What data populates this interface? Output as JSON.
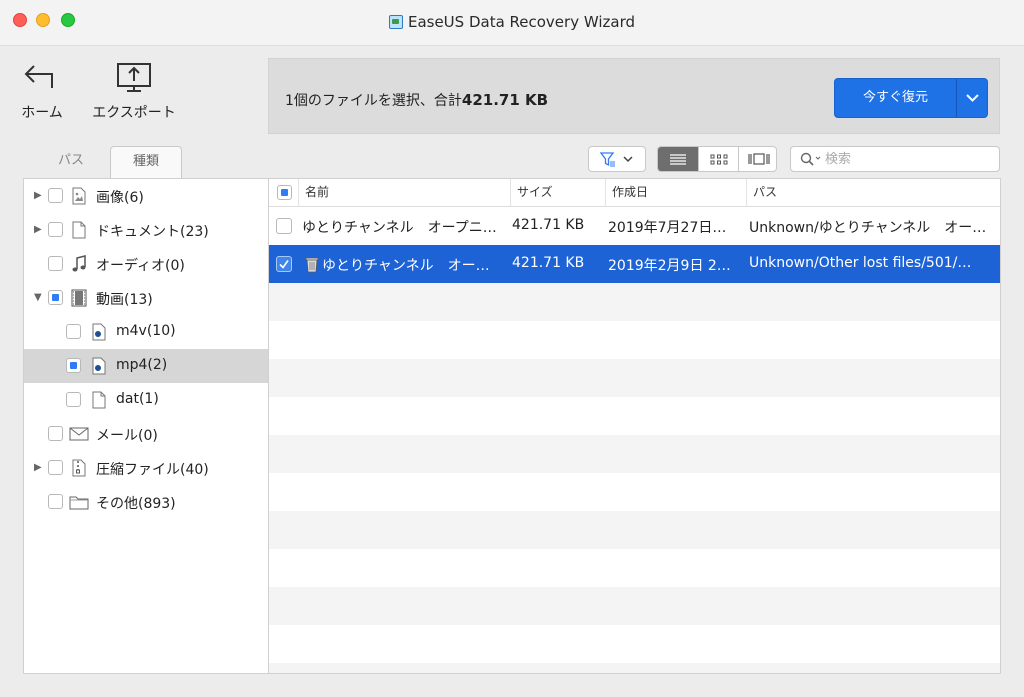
{
  "window": {
    "title": "EaseUS Data Recovery Wizard"
  },
  "toolbar": {
    "home_label": "ホーム",
    "export_label": "エクスポート"
  },
  "summary": {
    "prefix": "1個のファイルを選択、合計",
    "size": "421.71 KB"
  },
  "recover_button": {
    "label": "今すぐ復元"
  },
  "tabs": {
    "path": "パス",
    "type": "種類"
  },
  "tree": [
    {
      "label": "画像(6)",
      "icon": "image-file-icon"
    },
    {
      "label": "ドキュメント(23)",
      "icon": "document-icon"
    },
    {
      "label": "オーディオ(0)",
      "icon": "music-note-icon"
    },
    {
      "label": "動画(13)",
      "icon": "film-icon"
    },
    {
      "label": "m4v(10)",
      "icon": "video-file-icon"
    },
    {
      "label": "mp4(2)",
      "icon": "video-file-icon"
    },
    {
      "label": "dat(1)",
      "icon": "blank-file-icon"
    },
    {
      "label": "メール(0)",
      "icon": "envelope-icon"
    },
    {
      "label": "圧縮ファイル(40)",
      "icon": "zip-file-icon"
    },
    {
      "label": "その他(893)",
      "icon": "folder-icon"
    }
  ],
  "search": {
    "placeholder": "検索"
  },
  "table": {
    "columns": [
      "名前",
      "サイズ",
      "作成日",
      "パス"
    ],
    "rows": [
      {
        "name": "ゆとりチャンネル　オープニ…",
        "size": "421.71 KB",
        "date": "2019年7月27日…",
        "path": "Unknown/ゆとりチャンネル　オー…",
        "checked": false
      },
      {
        "name": "ゆとりチャンネル　オー…",
        "size": "421.71 KB",
        "date": "2019年2月9日 2…",
        "path": "Unknown/Other lost files/501/…",
        "checked": true
      }
    ]
  },
  "colors": {
    "accent": "#1f72e6",
    "selection": "#1d63d6"
  }
}
